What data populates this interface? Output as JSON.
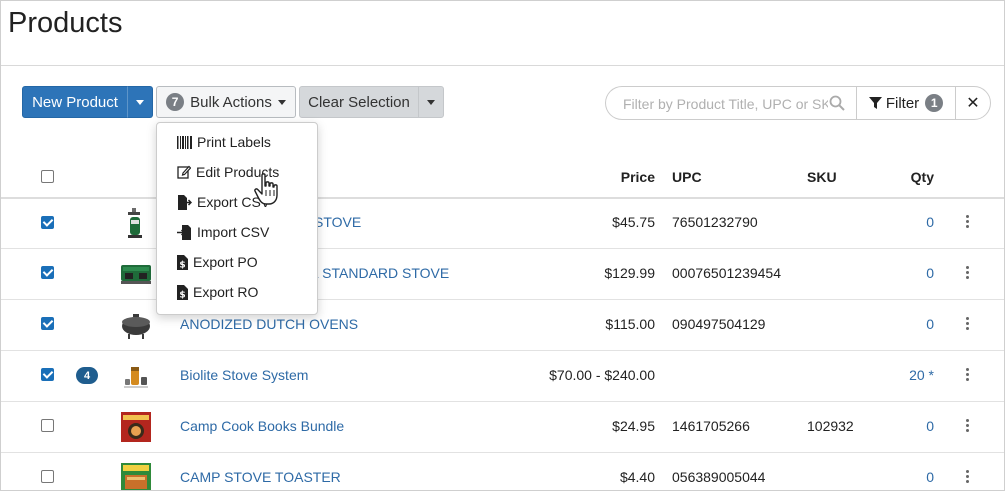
{
  "page": {
    "title": "Products"
  },
  "toolbar": {
    "new_product": "New Product",
    "bulk_count": "7",
    "bulk_actions": "Bulk Actions",
    "clear_selection": "Clear Selection",
    "search_placeholder": "Filter by Product Title, UPC or SKU",
    "filter_label": "Filter",
    "filter_count": "1"
  },
  "bulk_menu": {
    "items": [
      {
        "label": "Print Labels",
        "icon": "barcode-icon"
      },
      {
        "label": "Edit Products",
        "icon": "edit-icon"
      },
      {
        "label": "Export CSV",
        "icon": "file-export-icon"
      },
      {
        "label": "Import CSV",
        "icon": "file-import-icon"
      },
      {
        "label": "Export PO",
        "icon": "file-dollar-icon"
      },
      {
        "label": "Export RO",
        "icon": "file-dollar-icon"
      }
    ]
  },
  "table": {
    "headers": {
      "price": "Price",
      "upc": "UPC",
      "sku": "SKU",
      "qty": "Qty"
    },
    "rows": [
      {
        "checked": true,
        "badge": "",
        "title": "STOVE",
        "price": "$45.75",
        "upc": "76501232790",
        "sku": "",
        "qty": "0"
      },
      {
        "checked": true,
        "badge": "",
        "title": "L STANDARD STOVE",
        "price": "$129.99",
        "upc": "00076501239454",
        "sku": "",
        "qty": "0"
      },
      {
        "checked": true,
        "badge": "",
        "title": "ANODIZED DUTCH OVENS",
        "price": "$115.00",
        "upc": "090497504129",
        "sku": "",
        "qty": "0"
      },
      {
        "checked": true,
        "badge": "4",
        "title": "Biolite Stove System",
        "price": "$70.00 - $240.00",
        "upc": "",
        "sku": "",
        "qty": "20 *"
      },
      {
        "checked": false,
        "badge": "",
        "title": "Camp Cook Books Bundle",
        "price": "$24.95",
        "upc": "1461705266",
        "sku": "102932",
        "qty": "0"
      },
      {
        "checked": false,
        "badge": "",
        "title": "CAMP STOVE TOASTER",
        "price": "$4.40",
        "upc": "056389005044",
        "sku": "",
        "qty": "0"
      }
    ]
  },
  "colors": {
    "primary": "#2d74b8",
    "link": "#2e6aa6",
    "badge_dark": "#1f5d8e",
    "checkbox": "#1a6fb8"
  }
}
